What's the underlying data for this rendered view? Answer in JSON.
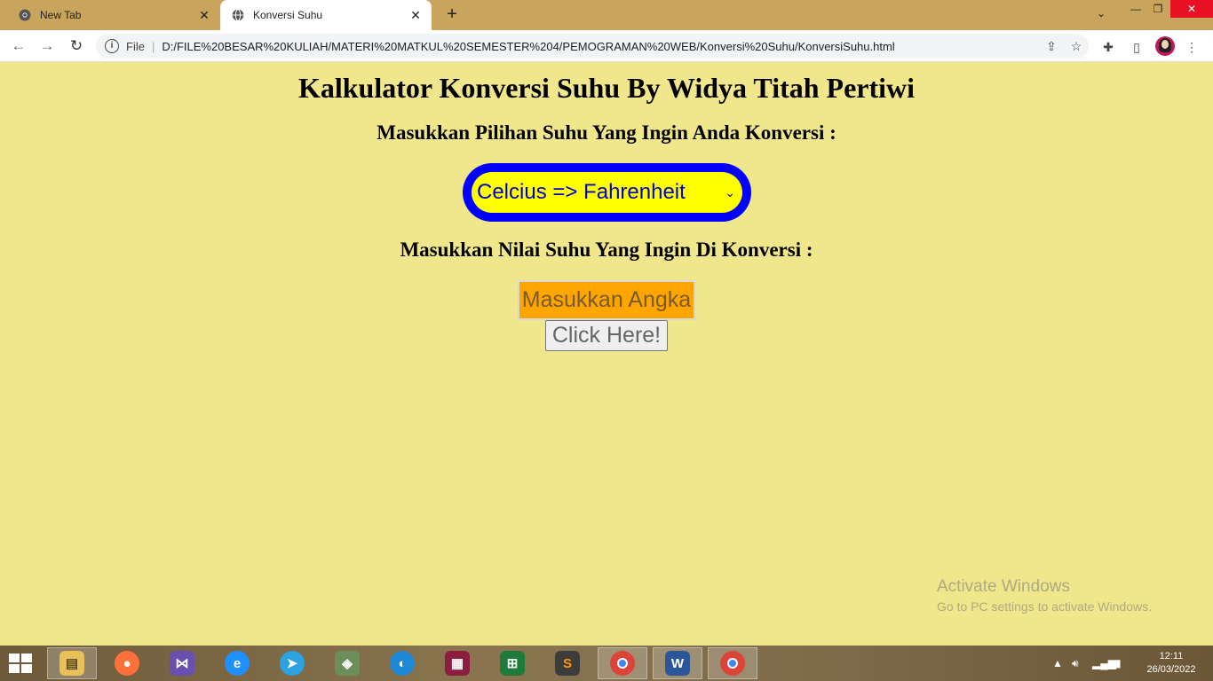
{
  "browser": {
    "tabs": [
      {
        "title": "New Tab",
        "active": false
      },
      {
        "title": "Konversi Suhu",
        "active": true
      }
    ],
    "address": {
      "scheme_label": "File",
      "url": "D:/FILE%20BESAR%20KULIAH/MATERI%20MATKUL%20SEMESTER%204/PEMOGRAMAN%20WEB/Konversi%20Suhu/KonversiSuhu.html"
    }
  },
  "page": {
    "title": "Kalkulator Konversi Suhu By Widya Titah Pertiwi",
    "select_prompt": "Masukkan Pilihan Suhu Yang Ingin Anda Konversi :",
    "select_value": "Celcius => Fahrenheit",
    "input_prompt": "Masukkan Nilai Suhu Yang Ingin Di Konversi :",
    "input_placeholder": "Masukkan Angka",
    "button_label": "Click Here!"
  },
  "watermark": {
    "line1": "Activate Windows",
    "line2": "Go to PC settings to activate Windows."
  },
  "taskbar": {
    "apps": [
      "file-explorer",
      "firefox",
      "visual-studio",
      "internet-explorer",
      "telegram",
      "virtualbox",
      "edge",
      "winrar",
      "excel",
      "sublime-text",
      "chrome",
      "word",
      "chrome"
    ],
    "time": "12:11",
    "date": "26/03/2022"
  },
  "colors": {
    "page_bg": "#f0e68c",
    "select_border": "#0000ff",
    "select_bg": "#ffff00",
    "input_bg": "#ffa500",
    "tabstrip": "#c9a45c"
  }
}
